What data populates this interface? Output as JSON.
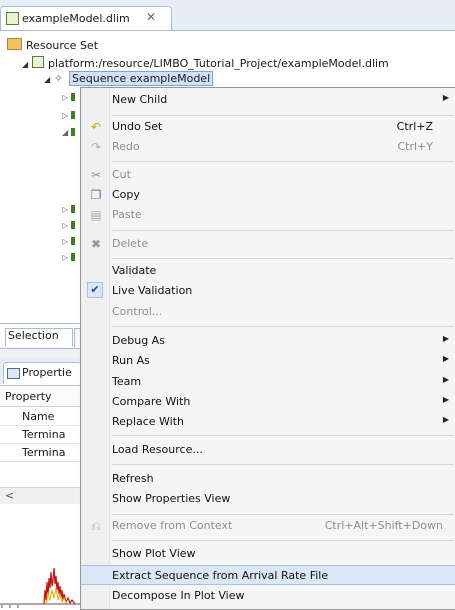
{
  "editor": {
    "tab_title": "exampleModel.dlim",
    "tab_close": "✕",
    "icon": "dlim-file-icon"
  },
  "tree": {
    "root_label": "Resource Set",
    "resource_label": "platform:/resource/LIMBO_Tutorial_Project/exampleModel.dlim",
    "sequence_label": "Sequence exampleModel"
  },
  "lower_left": {
    "selection_tab": "Selection",
    "properties_tab": "Propertie",
    "property_header": "Property",
    "rows": [
      "Name",
      "Termina",
      "Termina"
    ],
    "scroll_left": "<"
  },
  "context_menu": {
    "new_child": "New Child",
    "undo": "Undo Set",
    "undo_shortcut": "Ctrl+Z",
    "redo": "Redo",
    "redo_shortcut": "Ctrl+Y",
    "cut": "Cut",
    "copy": "Copy",
    "paste": "Paste",
    "delete": "Delete",
    "validate": "Validate",
    "live_validation": "Live Validation",
    "control": "Control...",
    "debug_as": "Debug As",
    "run_as": "Run As",
    "team": "Team",
    "compare_with": "Compare With",
    "replace_with": "Replace With",
    "load_resource": "Load Resource...",
    "refresh": "Refresh",
    "show_properties_view": "Show Properties View",
    "remove_from_context": "Remove from Context",
    "remove_shortcut": "Ctrl+Alt+Shift+Down",
    "show_plot_view": "Show Plot View",
    "extract_sequence": "Extract Sequence from Arrival Rate File",
    "decompose": "Decompose In Plot View"
  },
  "colors": {
    "menu_bg": "#f5f5f5",
    "hover_bg": "#dbe7f6",
    "selection_bg": "#cfe2f6",
    "tab_bar": "#e6edf6"
  }
}
